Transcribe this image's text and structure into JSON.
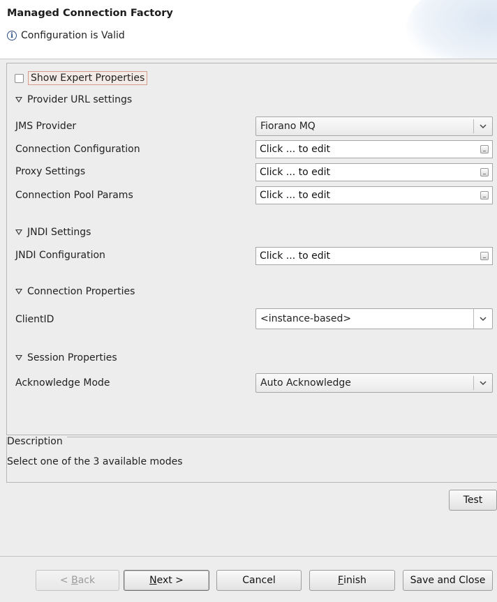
{
  "header": {
    "title": "Managed Connection Factory",
    "status_message": "Configuration is Valid",
    "status_icon": "info-icon"
  },
  "options": {
    "show_expert_label": "Show Expert Properties",
    "show_expert_checked": false
  },
  "sections": {
    "provider": {
      "title": "Provider URL settings",
      "jms_provider_label": "JMS Provider",
      "jms_provider_value": "Fiorano MQ",
      "connection_config_label": "Connection Configuration",
      "connection_config_value": "Click ... to edit",
      "proxy_label": "Proxy Settings",
      "proxy_value": "Click ... to edit",
      "pool_label": "Connection Pool Params",
      "pool_value": "Click ... to edit"
    },
    "jndi": {
      "title": "JNDI Settings",
      "config_label": "JNDI Configuration",
      "config_value": "Click ... to edit"
    },
    "connection": {
      "title": "Connection Properties",
      "client_id_label": "ClientID",
      "client_id_value": "<instance-based>"
    },
    "session": {
      "title": "Session Properties",
      "ack_mode_label": "Acknowledge Mode",
      "ack_mode_value": "Auto Acknowledge"
    }
  },
  "description": {
    "title": "Description",
    "text": "Select one of the 3 available modes"
  },
  "buttons": {
    "test": "Test",
    "back_mnemonic": "B",
    "back_prefix": "< ",
    "back_rest": "ack",
    "next_mnemonic": "N",
    "next_rest": "ext >",
    "cancel": "Cancel",
    "finish_mnemonic": "F",
    "finish_rest": "inish",
    "save_close": "Save and Close"
  }
}
